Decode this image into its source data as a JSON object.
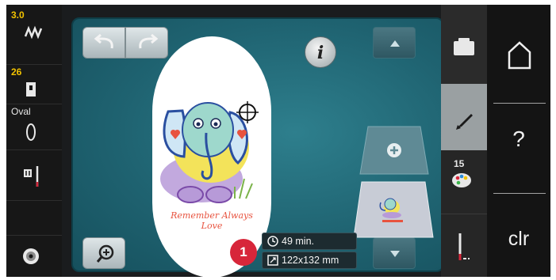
{
  "left_status": {
    "stitch_width": "3.0",
    "needle_label": "26",
    "hoop_label": "Oval"
  },
  "tabs": {
    "color_count": "15"
  },
  "design_info": {
    "time": "49 min.",
    "size": "122x132 mm"
  },
  "embroidery": {
    "caption": "Remember Always Love"
  },
  "callout": {
    "number": "1"
  },
  "nav": {
    "clear_label": "clr",
    "help_label": "?"
  },
  "colors": {
    "accent_red": "#d7263a",
    "canvas_teal": "#1f6371"
  }
}
